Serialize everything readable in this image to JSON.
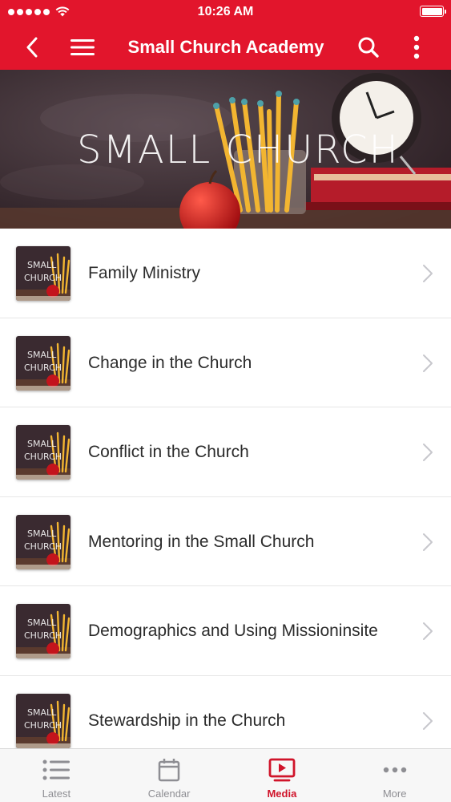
{
  "status_bar": {
    "time": "10:26 AM"
  },
  "nav": {
    "title": "Small Church Academy",
    "icons": [
      "chevron-left-icon",
      "hamburger-menu-icon",
      "search-icon",
      "vertical-dots-icon"
    ]
  },
  "banner": {
    "text": "SMALL CHURCH"
  },
  "thumb_text": [
    "SMALL",
    "CHURCH"
  ],
  "items": [
    {
      "label": "Family Ministry"
    },
    {
      "label": "Change in the Church"
    },
    {
      "label": "Conflict in the Church"
    },
    {
      "label": "Mentoring in the Small Church"
    },
    {
      "label": "Demographics and Using Missioninsite"
    },
    {
      "label": "Stewardship in the Church"
    }
  ],
  "tabs": [
    {
      "label": "Latest",
      "icon": "list-icon",
      "active": false
    },
    {
      "label": "Calendar",
      "icon": "calendar-icon",
      "active": false
    },
    {
      "label": "Media",
      "icon": "media-play-icon",
      "active": true
    },
    {
      "label": "More",
      "icon": "more-dots-icon",
      "active": false
    }
  ],
  "colors": {
    "brand_red": "#e2152c",
    "active_tab": "#d0142a",
    "inactive_tab": "#8e8e93"
  }
}
